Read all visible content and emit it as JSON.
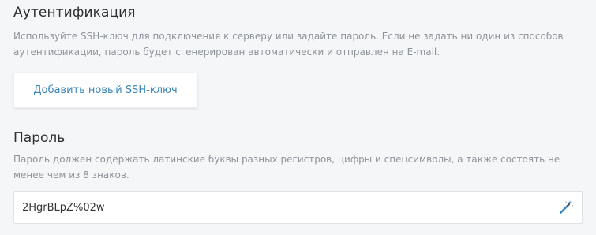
{
  "auth": {
    "title": "Аутентификация",
    "description": "Используйте SSH-ключ для подключения к серверу или задайте пароль. Если не задать ни один из способов аутентификации, пароль будет сгенерирован автоматически и отправлен на E-mail.",
    "add_key_label": "Добавить новый SSH-ключ"
  },
  "password": {
    "title": "Пароль",
    "description": "Пароль должен содержать латинские буквы разных регистров, цифры и спецсимволы, а также состоять не менее чем из 8 знаков.",
    "value": "2HgrBLpZ%02w",
    "generate_icon": "magic-wand-icon"
  },
  "colors": {
    "accent": "#3b86b8",
    "background": "#f5f6f8",
    "muted_text": "#8e949b"
  }
}
